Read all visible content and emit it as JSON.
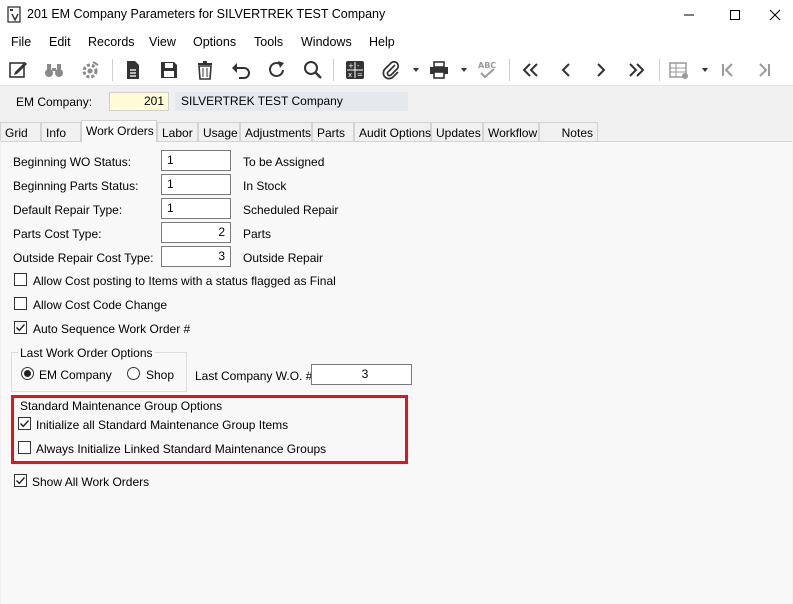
{
  "window": {
    "title": "201 EM Company Parameters for SILVERTREK TEST Company"
  },
  "menu": [
    "File",
    "Edit",
    "Records",
    "View",
    "Options",
    "Tools",
    "Windows",
    "Help"
  ],
  "toolbar": {
    "icons": [
      "edit-icon",
      "binoculars-icon",
      "settings-icon",
      "document-icon",
      "save-icon",
      "delete-icon",
      "undo-icon",
      "refresh-icon",
      "search-icon",
      "calculator-icon",
      "attach-icon",
      "print-icon",
      "spellcheck-icon",
      "first-record-icon",
      "previous-record-icon",
      "next-record-icon",
      "last-record-icon",
      "grid-view-icon",
      "first-icon",
      "last-icon"
    ]
  },
  "company": {
    "label": "EM Company:",
    "number": "201",
    "name": "SILVERTREK TEST Company"
  },
  "tabs": [
    "Grid",
    "Info",
    "Work Orders",
    "Labor",
    "Usage",
    "Adjustments",
    "Parts",
    "Audit Options",
    "Updates",
    "Workflow",
    "Notes"
  ],
  "active_tab": "Work Orders",
  "fields": {
    "beginning_wo_status": {
      "label": "Beginning WO Status:",
      "value": "1",
      "desc": "To be Assigned"
    },
    "beginning_parts_status": {
      "label": "Beginning Parts Status:",
      "value": "1",
      "desc": "In Stock"
    },
    "default_repair_type": {
      "label": "Default Repair Type:",
      "value": "1",
      "desc": "Scheduled Repair"
    },
    "parts_cost_type": {
      "label": "Parts Cost Type:",
      "value": "2",
      "desc": "Parts"
    },
    "outside_repair_cost_type": {
      "label": "Outside Repair Cost Type:",
      "value": "3",
      "desc": "Outside Repair"
    }
  },
  "checkboxes": {
    "allow_cost_posting": {
      "label": "Allow Cost posting to Items with a status flagged as Final",
      "checked": false
    },
    "allow_cost_code_change": {
      "label": "Allow Cost Code Change",
      "checked": false
    },
    "auto_sequence_wo": {
      "label": "Auto Sequence Work Order #",
      "checked": true
    },
    "init_all_std_maint": {
      "label": "Initialize all Standard Maintenance Group Items",
      "checked": true
    },
    "always_init_linked": {
      "label": "Always Initialize Linked Standard Maintenance Groups",
      "checked": false
    },
    "show_all_work_orders": {
      "label": "Show All Work Orders",
      "checked": true
    }
  },
  "last_wo_options": {
    "title": "Last Work Order Options",
    "radio_em_company": "EM Company",
    "radio_shop": "Shop",
    "selected": "EM Company",
    "last_company_wo_label": "Last Company W.O. #:",
    "last_company_wo_value": "3"
  },
  "std_maint_group": {
    "title": "Standard Maintenance Group Options"
  },
  "colors": {
    "highlight_border": "#e0161d",
    "company_number_bg": "#fffcd6",
    "company_name_bg": "#e5e9ee"
  }
}
